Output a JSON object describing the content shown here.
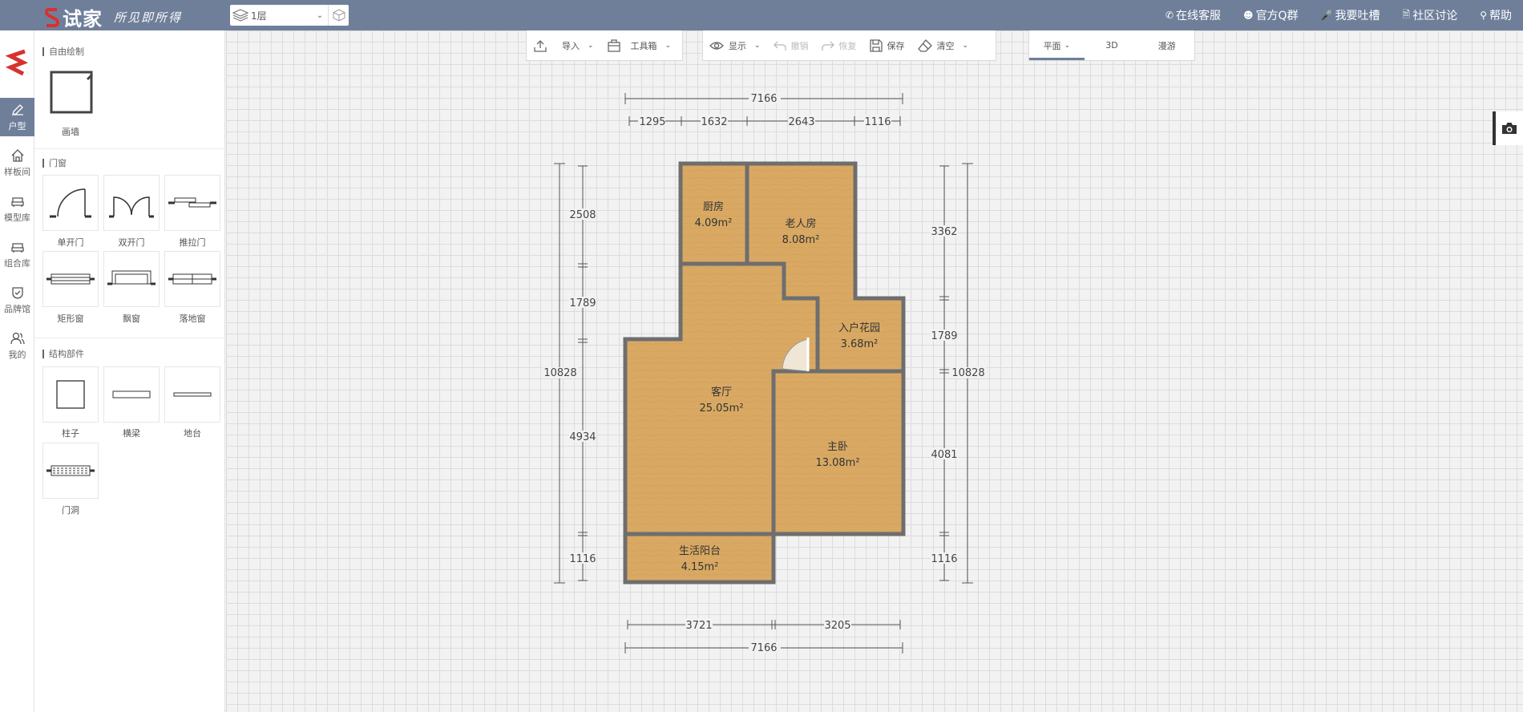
{
  "app": {
    "brand": "试家",
    "slogan": "所见即所得"
  },
  "floor": {
    "selected": "1层"
  },
  "top_links": [
    {
      "icon": "phone-icon",
      "label": "在线客服"
    },
    {
      "icon": "user-icon",
      "label": "官方Q群"
    },
    {
      "icon": "mic-icon",
      "label": "我要吐槽"
    },
    {
      "icon": "doc-icon",
      "label": "社区讨论"
    },
    {
      "icon": "search-icon",
      "label": "帮助"
    }
  ],
  "rail": [
    {
      "icon": "pencil-icon",
      "label": "户型",
      "active": true
    },
    {
      "icon": "home-icon",
      "label": "样板间"
    },
    {
      "icon": "sofa-icon",
      "label": "模型库"
    },
    {
      "icon": "sofa-icon",
      "label": "组合库"
    },
    {
      "icon": "shield-icon",
      "label": "品牌馆"
    },
    {
      "icon": "user-icon",
      "label": "我的"
    }
  ],
  "panel": {
    "sections": [
      {
        "title": "自由绘制",
        "items": [
          "画墙"
        ]
      },
      {
        "title": "门窗",
        "items": [
          "单开门",
          "双开门",
          "推拉门",
          "矩形窗",
          "飘窗",
          "落地窗"
        ]
      },
      {
        "title": "结构部件",
        "items": [
          "柱子",
          "横梁",
          "地台",
          "门洞"
        ]
      }
    ]
  },
  "toolbar": {
    "group1": [
      {
        "label": "导入",
        "icon": "upload-icon",
        "dropdown": true
      },
      {
        "label": "工具箱",
        "icon": "toolbox-icon",
        "dropdown": true
      }
    ],
    "group2": [
      {
        "label": "显示",
        "icon": "eye-icon",
        "dropdown": true,
        "disabled": false
      },
      {
        "label": "撤销",
        "icon": "undo-icon",
        "dropdown": false,
        "disabled": true
      },
      {
        "label": "恢复",
        "icon": "redo-icon",
        "dropdown": false,
        "disabled": true
      },
      {
        "label": "保存",
        "icon": "save-icon",
        "dropdown": false,
        "disabled": false
      },
      {
        "label": "清空",
        "icon": "eraser-icon",
        "dropdown": true,
        "disabled": false
      }
    ],
    "views": [
      {
        "label": "平面",
        "active": true,
        "dropdown": true
      },
      {
        "label": "3D"
      },
      {
        "label": "漫游"
      }
    ]
  },
  "floorplan": {
    "rooms": [
      {
        "name": "厨房",
        "area": "4.09m²"
      },
      {
        "name": "老人房",
        "area": "8.08m²"
      },
      {
        "name": "入户花园",
        "area": "3.68m²"
      },
      {
        "name": "客厅",
        "area": "25.05m²"
      },
      {
        "name": "主卧",
        "area": "13.08m²"
      },
      {
        "name": "生活阳台",
        "area": "4.15m²"
      }
    ],
    "dims": {
      "top_total": "7166",
      "top_segments": [
        "1295",
        "1632",
        "2643",
        "1116"
      ],
      "bottom_segments": [
        "3721",
        "3205"
      ],
      "bottom_total": "7166",
      "left_total": "10828",
      "left_segments": [
        "2508",
        "1789",
        "4934",
        "1116"
      ],
      "right_segments": [
        "3362",
        "1789",
        "4081",
        "1116"
      ],
      "right_total": "10828"
    }
  },
  "colors": {
    "topbar": "#6f7f9a",
    "brand_red": "#d6322f",
    "floor": "#d9a964",
    "wall": "#6e6e6e"
  }
}
